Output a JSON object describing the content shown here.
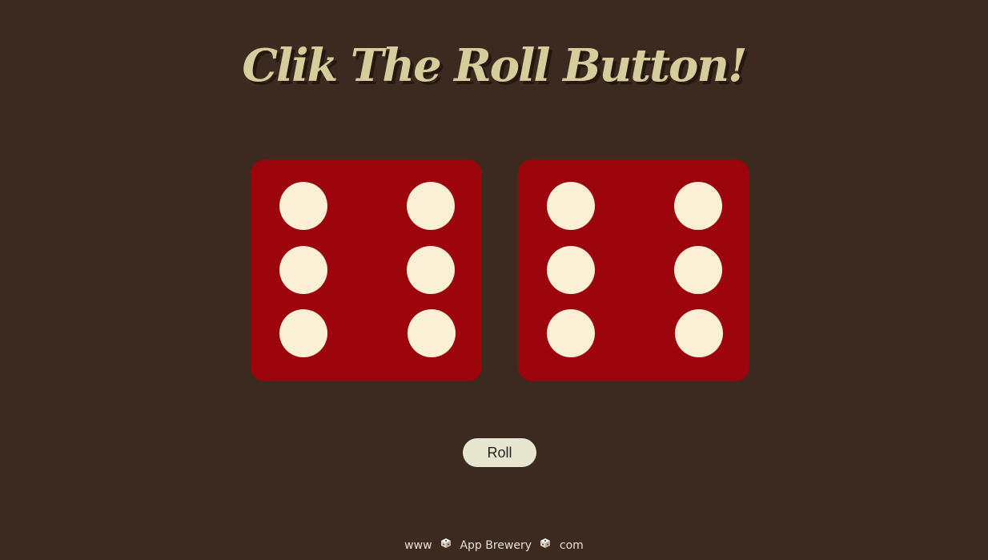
{
  "title": "Clik The Roll Button!",
  "dice": [
    {
      "value": 6
    },
    {
      "value": 6
    }
  ],
  "roll_button_label": "Roll",
  "footer": {
    "prefix": "www",
    "brand": "App Brewery",
    "suffix": "com",
    "icon": "dice-icon"
  },
  "colors": {
    "background": "#3c2a21",
    "title": "#d6cd9c",
    "die": "#9b050b",
    "pip": "#fbefd6",
    "button": "#e7e6cf"
  }
}
